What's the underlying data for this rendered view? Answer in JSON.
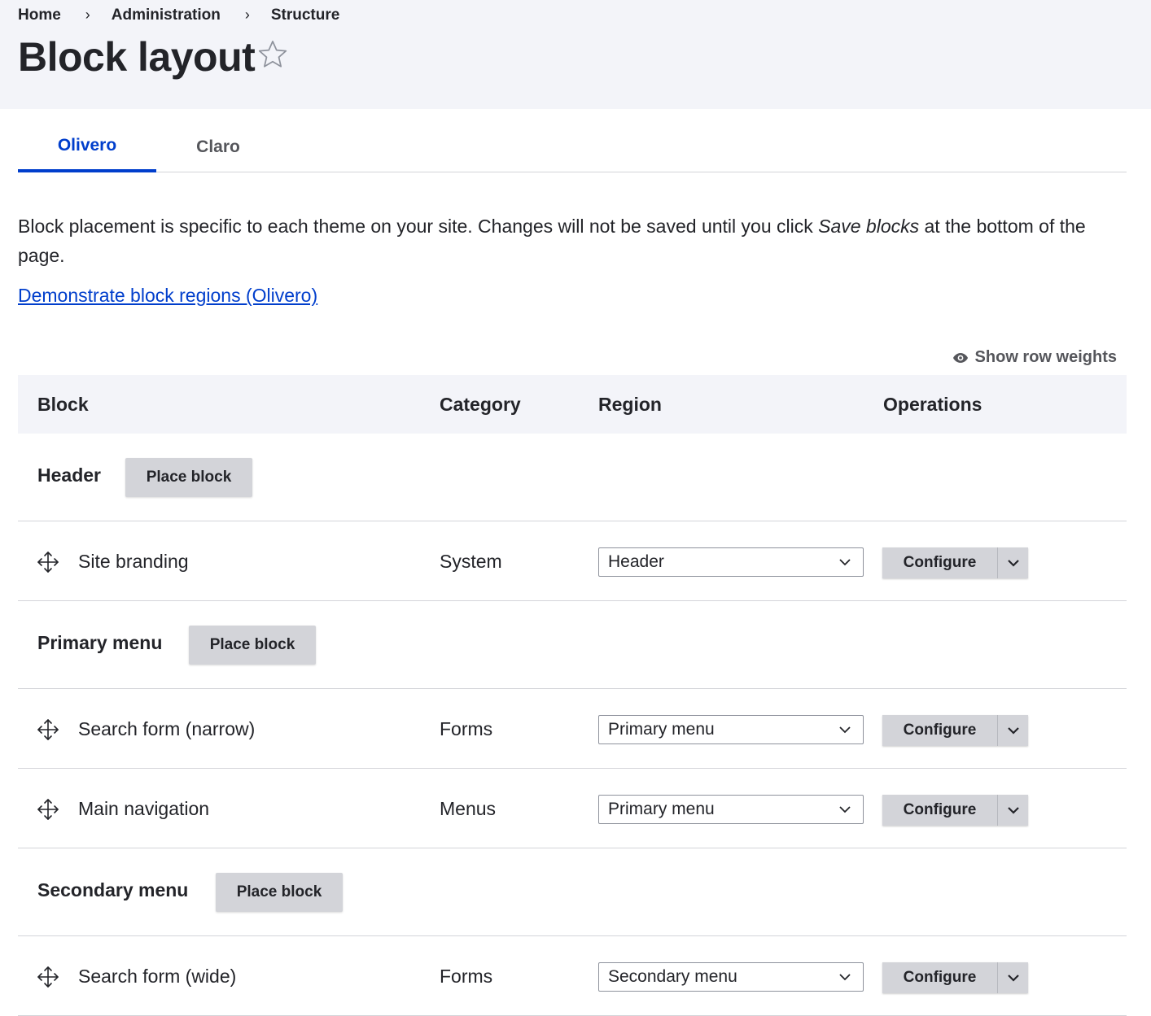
{
  "breadcrumb": [
    {
      "label": "Home"
    },
    {
      "label": "Administration"
    },
    {
      "label": "Structure"
    }
  ],
  "breadcrumb_separator": "›",
  "page": {
    "title": "Block layout",
    "favorite_icon": "star-outline-icon"
  },
  "tabs": [
    {
      "label": "Olivero",
      "active": true
    },
    {
      "label": "Claro",
      "active": false
    }
  ],
  "description": {
    "before": "Block placement is specific to each theme on your site. Changes will not be saved until you click ",
    "emphasis": "Save blocks",
    "after": " at the bottom of the page."
  },
  "demo_link": "Demonstrate block regions (Olivero)",
  "row_weights": {
    "label": "Show row weights",
    "icon": "eye-icon"
  },
  "table": {
    "headers": {
      "block": "Block",
      "category": "Category",
      "region": "Region",
      "operations": "Operations"
    },
    "regions": [
      {
        "title": "Header",
        "place_label": "Place block",
        "blocks": [
          {
            "name": "Site branding",
            "category": "System",
            "region": "Header",
            "configure_label": "Configure"
          }
        ]
      },
      {
        "title": "Primary menu",
        "place_label": "Place block",
        "blocks": [
          {
            "name": "Search form (narrow)",
            "category": "Forms",
            "region": "Primary menu",
            "configure_label": "Configure"
          },
          {
            "name": "Main navigation",
            "category": "Menus",
            "region": "Primary menu",
            "configure_label": "Configure"
          }
        ]
      },
      {
        "title": "Secondary menu",
        "place_label": "Place block",
        "blocks": [
          {
            "name": "Search form (wide)",
            "category": "Forms",
            "region": "Secondary menu",
            "configure_label": "Configure"
          }
        ]
      }
    ]
  },
  "colors": {
    "accent": "#003ecc",
    "header_bg": "#f3f4f9",
    "button_bg": "#d3d4d9",
    "text": "#232429"
  }
}
